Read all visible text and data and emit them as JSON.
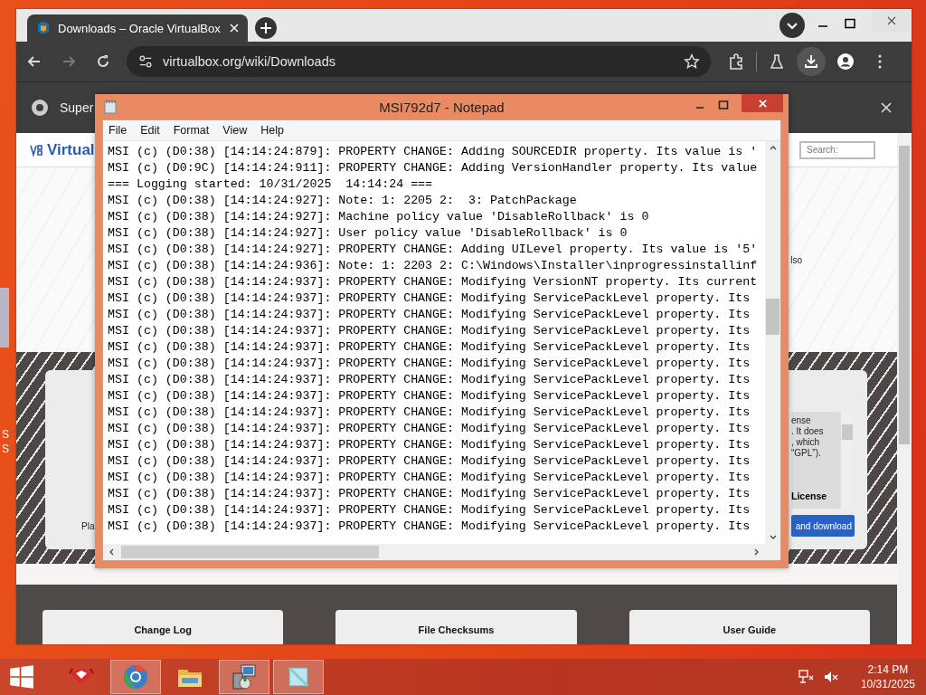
{
  "browser": {
    "tab": {
      "title": "Downloads – Oracle VirtualBox"
    },
    "address": "virtualbox.org/wiki/Downloads",
    "infobar": {
      "text": "Super"
    },
    "page": {
      "logo": "Virtual",
      "search": {
        "placeholder": "Search:"
      },
      "hero_text": "lso",
      "download_card": {
        "side_text": "Pla",
        "license_lines": [
          "ense",
          ". It does",
          ", which",
          "“GPL”)."
        ],
        "license_heading": "License",
        "button": "and download"
      },
      "resource_cards": [
        {
          "title": "Change Log"
        },
        {
          "title": "File Checksums"
        },
        {
          "title": "User Guide"
        }
      ]
    }
  },
  "notepad": {
    "title": "MSI792d7 - Notepad",
    "menu": [
      "File",
      "Edit",
      "Format",
      "View",
      "Help"
    ],
    "lines": [
      "MSI (c) (D0:38) [14:14:24:879]: PROPERTY CHANGE: Adding SOURCEDIR property. Its value is '",
      "MSI (c) (D0:9C) [14:14:24:911]: PROPERTY CHANGE: Adding VersionHandler property. Its value",
      "=== Logging started: 10/31/2025  14:14:24 ===",
      "MSI (c) (D0:38) [14:14:24:927]: Note: 1: 2205 2:  3: PatchPackage",
      "MSI (c) (D0:38) [14:14:24:927]: Machine policy value 'DisableRollback' is 0",
      "MSI (c) (D0:38) [14:14:24:927]: User policy value 'DisableRollback' is 0",
      "MSI (c) (D0:38) [14:14:24:927]: PROPERTY CHANGE: Adding UILevel property. Its value is '5'",
      "MSI (c) (D0:38) [14:14:24:936]: Note: 1: 2203 2: C:\\Windows\\Installer\\inprogressinstallinf",
      "MSI (c) (D0:38) [14:14:24:937]: PROPERTY CHANGE: Modifying VersionNT property. Its current",
      "MSI (c) (D0:38) [14:14:24:937]: PROPERTY CHANGE: Modifying ServicePackLevel property. Its",
      "MSI (c) (D0:38) [14:14:24:937]: PROPERTY CHANGE: Modifying ServicePackLevel property. Its",
      "MSI (c) (D0:38) [14:14:24:937]: PROPERTY CHANGE: Modifying ServicePackLevel property. Its",
      "MSI (c) (D0:38) [14:14:24:937]: PROPERTY CHANGE: Modifying ServicePackLevel property. Its",
      "MSI (c) (D0:38) [14:14:24:937]: PROPERTY CHANGE: Modifying ServicePackLevel property. Its",
      "MSI (c) (D0:38) [14:14:24:937]: PROPERTY CHANGE: Modifying ServicePackLevel property. Its",
      "MSI (c) (D0:38) [14:14:24:937]: PROPERTY CHANGE: Modifying ServicePackLevel property. Its",
      "MSI (c) (D0:38) [14:14:24:937]: PROPERTY CHANGE: Modifying ServicePackLevel property. Its",
      "MSI (c) (D0:38) [14:14:24:937]: PROPERTY CHANGE: Modifying ServicePackLevel property. Its",
      "MSI (c) (D0:38) [14:14:24:937]: PROPERTY CHANGE: Modifying ServicePackLevel property. Its",
      "MSI (c) (D0:38) [14:14:24:937]: PROPERTY CHANGE: Modifying ServicePackLevel property. Its",
      "MSI (c) (D0:38) [14:14:24:937]: PROPERTY CHANGE: Modifying ServicePackLevel property. Its",
      "MSI (c) (D0:38) [14:14:24:937]: PROPERTY CHANGE: Modifying ServicePackLevel property. Its",
      "MSI (c) (D0:38) [14:14:24:937]: PROPERTY CHANGE: Modifying ServicePackLevel property. Its",
      "MSI (c) (D0:38) [14:14:24:937]: PROPERTY CHANGE: Modifying ServicePackLevel property. Its"
    ]
  },
  "desktop_labels": [
    "S",
    "S"
  ],
  "taskbar": {
    "apps": [
      {
        "kind": "toolbox",
        "selected": false
      },
      {
        "kind": "browser",
        "selected": true
      },
      {
        "kind": "folder",
        "selected": false
      },
      {
        "kind": "installer",
        "selected": true
      },
      {
        "kind": "notepad",
        "selected": true
      }
    ],
    "time": "2:14 PM",
    "date": "10/31/2025"
  }
}
